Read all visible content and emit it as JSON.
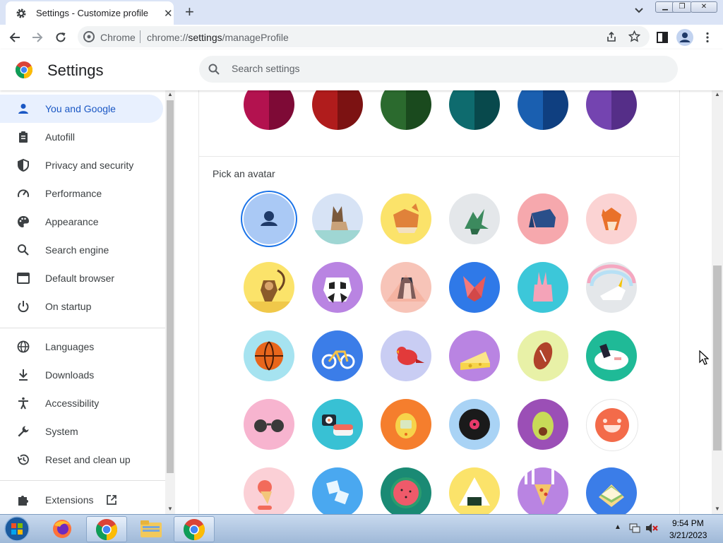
{
  "browser": {
    "tab_title": "Settings - Customize profile",
    "omnibox_site": "Chrome",
    "url_prefix": "chrome://",
    "url_host": "settings",
    "url_path": "/manageProfile",
    "window_buttons": [
      "minimize-icon",
      "restore-icon",
      "close-icon"
    ]
  },
  "header": {
    "title": "Settings",
    "search_placeholder": "Search settings"
  },
  "sidebar": {
    "items": [
      {
        "label": "You and Google",
        "icon": "person-icon",
        "active": true
      },
      {
        "label": "Autofill",
        "icon": "clipboard-icon"
      },
      {
        "label": "Privacy and security",
        "icon": "shield-icon"
      },
      {
        "label": "Performance",
        "icon": "speedometer-icon"
      },
      {
        "label": "Appearance",
        "icon": "palette-icon"
      },
      {
        "label": "Search engine",
        "icon": "search-icon"
      },
      {
        "label": "Default browser",
        "icon": "browser-window-icon"
      },
      {
        "label": "On startup",
        "icon": "power-icon"
      },
      {
        "label": "Languages",
        "icon": "globe-icon"
      },
      {
        "label": "Downloads",
        "icon": "download-icon"
      },
      {
        "label": "Accessibility",
        "icon": "accessibility-icon"
      },
      {
        "label": "System",
        "icon": "wrench-icon"
      },
      {
        "label": "Reset and clean up",
        "icon": "reset-history-icon"
      },
      {
        "label": "Extensions",
        "icon": "puzzle-icon"
      }
    ]
  },
  "main": {
    "theme_colors": [
      {
        "name": "rose",
        "left": "#b3124f",
        "right": "#7e0a36"
      },
      {
        "name": "red",
        "left": "#b01c1c",
        "right": "#7c1212"
      },
      {
        "name": "green",
        "left": "#2b6a2e",
        "right": "#1a4a1e"
      },
      {
        "name": "teal",
        "left": "#0e6b6e",
        "right": "#08494c"
      },
      {
        "name": "blue",
        "left": "#1a5fb0",
        "right": "#0f3f80"
      },
      {
        "name": "purple",
        "left": "#7444b0",
        "right": "#552e88"
      }
    ],
    "pick_avatar_heading": "Pick an avatar",
    "avatars": [
      {
        "name": "generic-person",
        "bg": "#aac9f5",
        "selected": true
      },
      {
        "name": "origami-cat",
        "bg": "#d7e3f5"
      },
      {
        "name": "origami-corgi",
        "bg": "#fbe36a"
      },
      {
        "name": "origami-dragon",
        "bg": "#e4e7ea"
      },
      {
        "name": "origami-elephant",
        "bg": "#f6a8ad"
      },
      {
        "name": "origami-fox",
        "bg": "#fbd3d3"
      },
      {
        "name": "origami-monkey",
        "bg": "#fbe36a"
      },
      {
        "name": "origami-panda",
        "bg": "#b984e2"
      },
      {
        "name": "origami-penguin",
        "bg": "#f7c4b8"
      },
      {
        "name": "origami-butterfly",
        "bg": "#2f79e8"
      },
      {
        "name": "origami-rabbit",
        "bg": "#3cc7d9"
      },
      {
        "name": "origami-unicorn",
        "bg": "#e4e7ea"
      },
      {
        "name": "basketball",
        "bg": "#a6e3f0"
      },
      {
        "name": "bicycle",
        "bg": "#3b7de8"
      },
      {
        "name": "bird",
        "bg": "#c9cdf3"
      },
      {
        "name": "cheese",
        "bg": "#b984e2"
      },
      {
        "name": "football",
        "bg": "#e8f1a7"
      },
      {
        "name": "sushi-plate",
        "bg": "#1fba97"
      },
      {
        "name": "sunglasses",
        "bg": "#f7b4cf"
      },
      {
        "name": "sushi",
        "bg": "#38c1d4"
      },
      {
        "name": "tamagotchi",
        "bg": "#f57e2d"
      },
      {
        "name": "vinyl-record",
        "bg": "#a9d3f5"
      },
      {
        "name": "avocado",
        "bg": "#9b4fb6"
      },
      {
        "name": "smiley",
        "bg": "#ffffff"
      },
      {
        "name": "ice-cream",
        "bg": "#fbd0d6"
      },
      {
        "name": "ice-cubes",
        "bg": "#4aa8f0"
      },
      {
        "name": "watermelon",
        "bg": "#1a8a74"
      },
      {
        "name": "onigiri",
        "bg": "#fbe36a"
      },
      {
        "name": "pizza",
        "bg": "#b984e2"
      },
      {
        "name": "sandwich",
        "bg": "#3b7de8"
      }
    ]
  },
  "taskbar": {
    "apps": [
      "windows-start-icon",
      "firefox-icon",
      "chrome-icon",
      "file-explorer-icon",
      "chrome-icon"
    ],
    "time": "9:54 PM",
    "date": "3/21/2023"
  }
}
